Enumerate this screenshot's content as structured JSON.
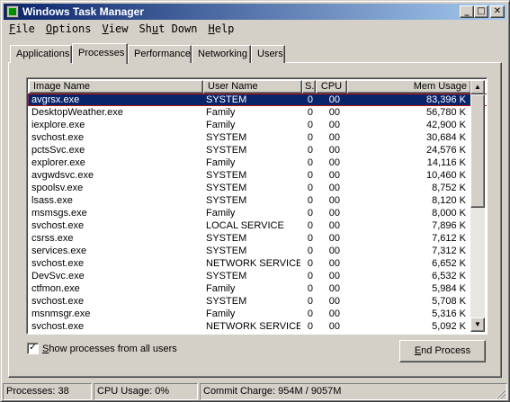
{
  "window": {
    "title": "Windows Task Manager"
  },
  "title_buttons": {
    "minimize": "_",
    "maximize": "□",
    "close": "✕"
  },
  "menu": [
    {
      "label_ul": "F",
      "label_rest": "ile"
    },
    {
      "label_ul": "O",
      "label_rest": "ptions"
    },
    {
      "label_ul": "V",
      "label_rest": "iew"
    },
    {
      "label_pre": "Sh",
      "label_ul": "u",
      "label_rest": "t Down"
    },
    {
      "label_ul": "H",
      "label_rest": "elp"
    }
  ],
  "tabs": [
    "Applications",
    "Processes",
    "Performance",
    "Networking",
    "Users"
  ],
  "active_tab": "Processes",
  "columns": {
    "name": "Image Name",
    "user": "User Name",
    "s": "S.",
    "cpu": "CPU",
    "mem": "Mem Usage"
  },
  "processes": [
    {
      "name": "avgrsx.exe",
      "user": "SYSTEM",
      "s": "0",
      "cpu": "00",
      "mem": "83,396 K",
      "selected": true
    },
    {
      "name": "DesktopWeather.exe",
      "user": "Family",
      "s": "0",
      "cpu": "00",
      "mem": "56,780 K"
    },
    {
      "name": "iexplore.exe",
      "user": "Family",
      "s": "0",
      "cpu": "00",
      "mem": "42,900 K"
    },
    {
      "name": "svchost.exe",
      "user": "SYSTEM",
      "s": "0",
      "cpu": "00",
      "mem": "30,684 K"
    },
    {
      "name": "pctsSvc.exe",
      "user": "SYSTEM",
      "s": "0",
      "cpu": "00",
      "mem": "24,576 K"
    },
    {
      "name": "explorer.exe",
      "user": "Family",
      "s": "0",
      "cpu": "00",
      "mem": "14,116 K"
    },
    {
      "name": "avgwdsvc.exe",
      "user": "SYSTEM",
      "s": "0",
      "cpu": "00",
      "mem": "10,460 K"
    },
    {
      "name": "spoolsv.exe",
      "user": "SYSTEM",
      "s": "0",
      "cpu": "00",
      "mem": "8,752 K"
    },
    {
      "name": "lsass.exe",
      "user": "SYSTEM",
      "s": "0",
      "cpu": "00",
      "mem": "8,120 K"
    },
    {
      "name": "msmsgs.exe",
      "user": "Family",
      "s": "0",
      "cpu": "00",
      "mem": "8,000 K"
    },
    {
      "name": "svchost.exe",
      "user": "LOCAL SERVICE",
      "s": "0",
      "cpu": "00",
      "mem": "7,896 K"
    },
    {
      "name": "csrss.exe",
      "user": "SYSTEM",
      "s": "0",
      "cpu": "00",
      "mem": "7,612 K"
    },
    {
      "name": "services.exe",
      "user": "SYSTEM",
      "s": "0",
      "cpu": "00",
      "mem": "7,312 K"
    },
    {
      "name": "svchost.exe",
      "user": "NETWORK SERVICE",
      "s": "0",
      "cpu": "00",
      "mem": "6,652 K"
    },
    {
      "name": "DevSvc.exe",
      "user": "SYSTEM",
      "s": "0",
      "cpu": "00",
      "mem": "6,532 K"
    },
    {
      "name": "ctfmon.exe",
      "user": "Family",
      "s": "0",
      "cpu": "00",
      "mem": "5,984 K"
    },
    {
      "name": "svchost.exe",
      "user": "SYSTEM",
      "s": "0",
      "cpu": "00",
      "mem": "5,708 K"
    },
    {
      "name": "msnmsgr.exe",
      "user": "Family",
      "s": "0",
      "cpu": "00",
      "mem": "5,316 K"
    },
    {
      "name": "svchost.exe",
      "user": "NETWORK SERVICE",
      "s": "0",
      "cpu": "00",
      "mem": "5,092 K"
    }
  ],
  "scrollbar": {
    "up_icon": "▲",
    "down_icon": "▼"
  },
  "show_all": {
    "checked": true,
    "check_glyph": "✓",
    "label_ul": "S",
    "label_rest": "how processes from all users"
  },
  "end_process": {
    "label_ul": "E",
    "label_rest": "nd Process"
  },
  "status": {
    "processes": "Processes: 38",
    "cpu": "CPU Usage: 0%",
    "commit": "Commit Charge: 954M / 9057M"
  },
  "colors": {
    "selection": "#0a246a",
    "selection_outline": "#b21818",
    "titlebar_start": "#0a246a",
    "titlebar_end": "#a6caf0"
  }
}
